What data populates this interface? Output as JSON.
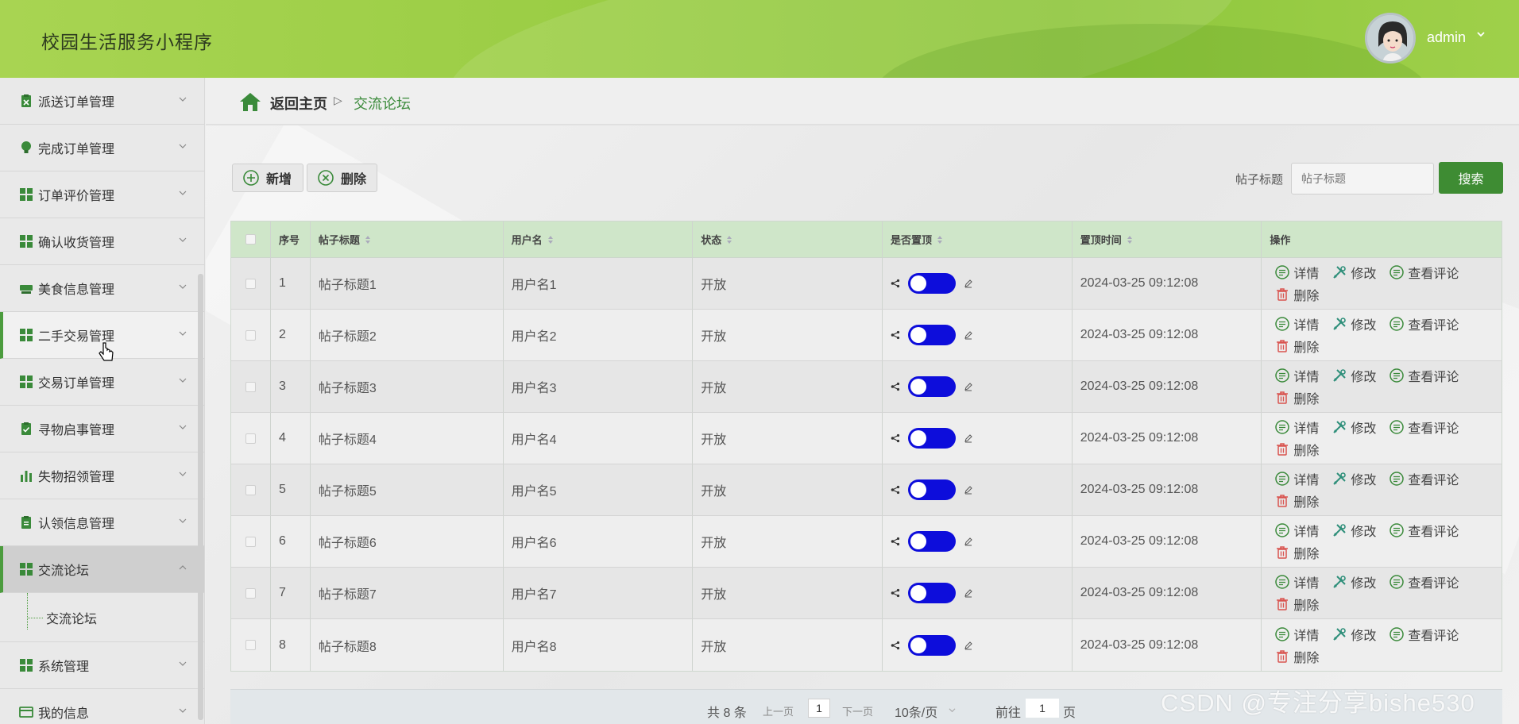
{
  "header": {
    "title": "校园生活服务小程序",
    "user": "admin"
  },
  "sidebar": {
    "items": [
      {
        "label": "派送订单管理",
        "icon": "clipboard-x-icon"
      },
      {
        "label": "完成订单管理",
        "icon": "bulb-icon"
      },
      {
        "label": "订单评价管理",
        "icon": "grid-icon"
      },
      {
        "label": "确认收货管理",
        "icon": "grid-icon"
      },
      {
        "label": "美食信息管理",
        "icon": "food-icon"
      },
      {
        "label": "二手交易管理",
        "icon": "grid-icon"
      },
      {
        "label": "交易订单管理",
        "icon": "grid-icon"
      },
      {
        "label": "寻物启事管理",
        "icon": "clipboard-check-icon"
      },
      {
        "label": "失物招领管理",
        "icon": "bar-chart-icon"
      },
      {
        "label": "认领信息管理",
        "icon": "clipboard-icon"
      },
      {
        "label": "交流论坛",
        "icon": "grid-icon"
      },
      {
        "label": "系统管理",
        "icon": "grid-icon"
      },
      {
        "label": "我的信息",
        "icon": "card-icon"
      }
    ],
    "submenu": {
      "label": "交流论坛"
    }
  },
  "breadcrumb": {
    "home": "返回主页",
    "sep": "▷",
    "current": "交流论坛"
  },
  "toolbar": {
    "add_label": "新增",
    "delete_label": "删除",
    "search_label": "帖子标题",
    "search_placeholder": "帖子标题",
    "search_button": "搜索"
  },
  "table": {
    "headers": [
      "序号",
      "帖子标题",
      "用户名",
      "状态",
      "是否置顶",
      "置顶时间",
      "操作"
    ],
    "rows": [
      {
        "no": "1",
        "title": "帖子标题1",
        "user": "用户名1",
        "status": "开放",
        "time": "2024-03-25 09:12:08"
      },
      {
        "no": "2",
        "title": "帖子标题2",
        "user": "用户名2",
        "status": "开放",
        "time": "2024-03-25 09:12:08"
      },
      {
        "no": "3",
        "title": "帖子标题3",
        "user": "用户名3",
        "status": "开放",
        "time": "2024-03-25 09:12:08"
      },
      {
        "no": "4",
        "title": "帖子标题4",
        "user": "用户名4",
        "status": "开放",
        "time": "2024-03-25 09:12:08"
      },
      {
        "no": "5",
        "title": "帖子标题5",
        "user": "用户名5",
        "status": "开放",
        "time": "2024-03-25 09:12:08"
      },
      {
        "no": "6",
        "title": "帖子标题6",
        "user": "用户名6",
        "status": "开放",
        "time": "2024-03-25 09:12:08"
      },
      {
        "no": "7",
        "title": "帖子标题7",
        "user": "用户名7",
        "status": "开放",
        "time": "2024-03-25 09:12:08"
      },
      {
        "no": "8",
        "title": "帖子标题8",
        "user": "用户名8",
        "status": "开放",
        "time": "2024-03-25 09:12:08"
      }
    ],
    "ops": {
      "detail": "详情",
      "edit": "修改",
      "comments": "查看评论",
      "delete": "删除"
    }
  },
  "pagination": {
    "total": "共 8 条",
    "prev": "上一页",
    "current": "1",
    "next": "下一页",
    "page_size": "10条/页",
    "goto_prefix": "前往",
    "goto_value": "1",
    "goto_suffix": "页"
  },
  "watermark": "CSDN @专注分享bishe530",
  "colors": {
    "accent": "#3e8c33",
    "toggle": "#0d0ddb",
    "header_green": "#9acd44",
    "table_header": "#cfe6c9"
  }
}
